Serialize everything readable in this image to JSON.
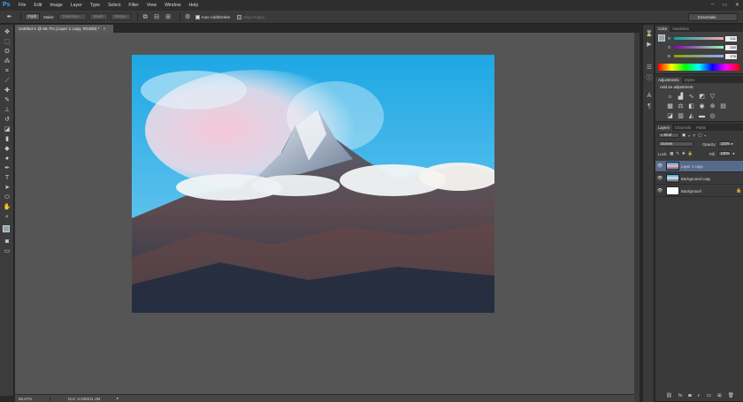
{
  "app": {
    "logo": "Ps"
  },
  "menu": [
    "File",
    "Edit",
    "Image",
    "Layer",
    "Type",
    "Select",
    "Filter",
    "View",
    "Window",
    "Help"
  ],
  "window_controls": {
    "minimize": "–",
    "maximize": "▭",
    "close": "✕"
  },
  "options": {
    "mode_value": "Path",
    "make_label": "Make:",
    "selection_btn": "Selection...",
    "mask_btn": "Mask",
    "shape_btn": "Shape",
    "auto_add_delete": "Auto Add/Delete",
    "auto_add_checked": true,
    "align_edges": "Align Edges",
    "align_edges_checked": false,
    "workspace": "Essentials"
  },
  "document": {
    "tab_title": "Untitled-1 @ 66.7% (Layer 1 copy, RGB/8) *",
    "tab_close": "×"
  },
  "status": {
    "zoom": "66.67%",
    "doc_info": "Doc: 6.03M/11.3M",
    "arrow": "▸"
  },
  "color_panel": {
    "tabs": [
      "Color",
      "Swatches"
    ],
    "sliders": [
      {
        "label": "R",
        "value": "141"
      },
      {
        "label": "G",
        "value": "165"
      },
      {
        "label": "B",
        "value": "176"
      }
    ],
    "foreground_color": "#8da5b0"
  },
  "adjustments_panel": {
    "tabs": [
      "Adjustments",
      "Styles"
    ],
    "heading": "Add an adjustment"
  },
  "layers_panel": {
    "tabs": [
      "Layers",
      "Channels",
      "Paths"
    ],
    "kind_label": "Kind",
    "blend_mode": "Screen",
    "opacity_label": "Opacity:",
    "opacity_value": "100%",
    "lock_label": "Lock:",
    "fill_label": "Fill:",
    "fill_value": "100%",
    "layers": [
      {
        "name": "Layer 1 copy",
        "selected": true
      },
      {
        "name": "Background copy",
        "selected": false
      },
      {
        "name": "Background",
        "selected": false
      }
    ]
  },
  "colors": {
    "app_bg": "#282828",
    "canvas_bg": "#555555",
    "selected_layer": "#566a8b",
    "accent": "#31a8ff"
  }
}
